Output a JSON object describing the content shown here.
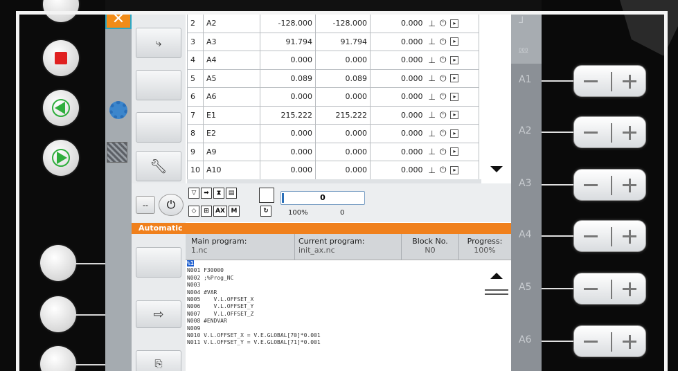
{
  "table": {
    "rows": [
      {
        "idx": "2",
        "name": "A2",
        "v1": "-128.000",
        "v2": "-128.000",
        "v3": "0.000"
      },
      {
        "idx": "3",
        "name": "A3",
        "v1": "91.794",
        "v2": "91.794",
        "v3": "0.000"
      },
      {
        "idx": "4",
        "name": "A4",
        "v1": "0.000",
        "v2": "0.000",
        "v3": "0.000"
      },
      {
        "idx": "5",
        "name": "A5",
        "v1": "0.089",
        "v2": "0.089",
        "v3": "0.000"
      },
      {
        "idx": "6",
        "name": "A6",
        "v1": "0.000",
        "v2": "0.000",
        "v3": "0.000"
      },
      {
        "idx": "7",
        "name": "E1",
        "v1": "215.222",
        "v2": "215.222",
        "v3": "0.000"
      },
      {
        "idx": "8",
        "name": "E2",
        "v1": "0.000",
        "v2": "0.000",
        "v3": "0.000"
      },
      {
        "idx": "9",
        "name": "A9",
        "v1": "0.000",
        "v2": "0.000",
        "v3": "0.000"
      },
      {
        "idx": "10",
        "name": "A10",
        "v1": "0.000",
        "v2": "0.000",
        "v3": "0.000"
      }
    ]
  },
  "status": {
    "override_value": "0",
    "override_percent": "100%",
    "override_zero": "0",
    "ax_label": "AX",
    "minus_label": "--"
  },
  "mode": "Automatic",
  "program": {
    "main_label": "Main program:",
    "main_value": "1.nc",
    "current_label": "Current program:",
    "current_value": "init_ax.nc",
    "block_label": "Block No.",
    "block_value": "N0",
    "progress_label": "Progress:",
    "progress_value": "100%"
  },
  "code": {
    "cursor_line": "%1",
    "lines": [
      "N001 F30000",
      "N002 ;%Prog_NC",
      "N003",
      "N004 #VAR",
      "N005    V.L.OFFSET_X",
      "N006    V.L.OFFSET_Y",
      "N007    V.L.OFFSET_Z",
      "N008 #ENDVAR",
      "N009",
      "N010 V.L.OFFSET_X = V.E.GLOBAL[70]*0.001",
      "N011 V.L.OFFSET_Y = V.E.GLOBAL[71]*0.001"
    ]
  },
  "jog_axes": [
    "A1",
    "A2",
    "A3",
    "A4",
    "A5",
    "A6"
  ],
  "colors": {
    "accent_orange": "#f0801c",
    "stop_red": "#e02020",
    "play_green": "#2fae3d",
    "highlight_blue": "#1e5fd0"
  }
}
